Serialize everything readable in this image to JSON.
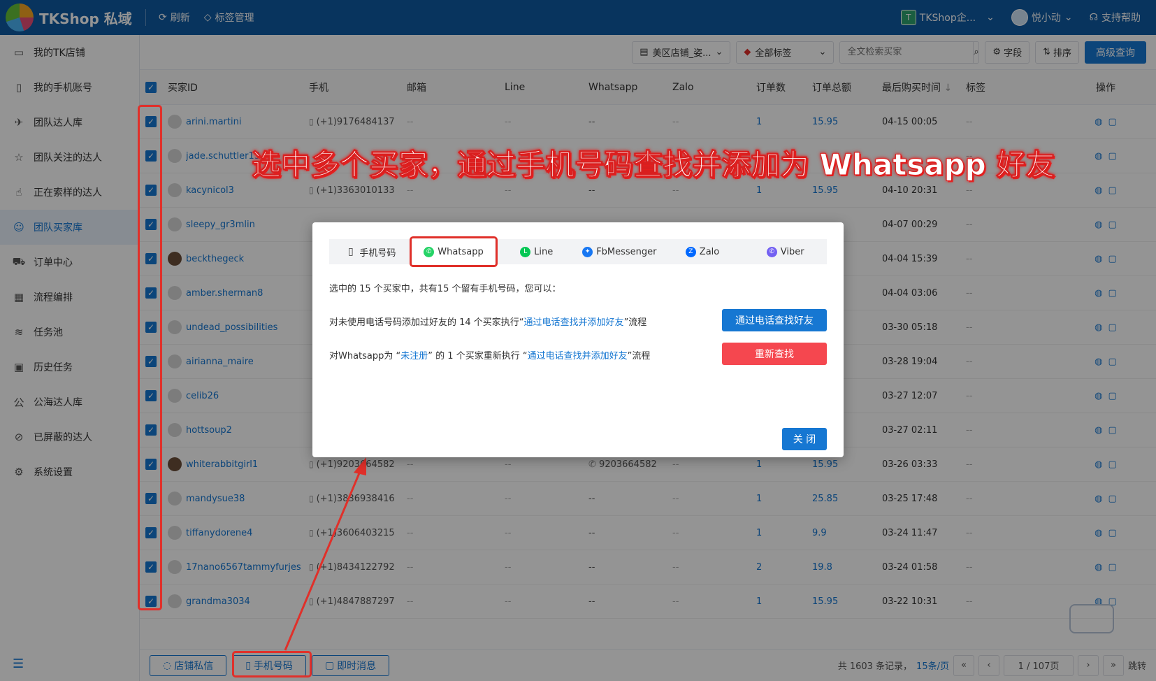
{
  "app": {
    "title": "TKShop 私域"
  },
  "topbar": {
    "refresh": "刷新",
    "tags": "标签管理",
    "org_badge": "T",
    "org": "TKShop企...",
    "user": "悦小动",
    "help": "支持帮助"
  },
  "sidebar": {
    "items": [
      {
        "label": "我的TK店铺",
        "icon": "store-icon",
        "glyph": "▭"
      },
      {
        "label": "我的手机账号",
        "icon": "phone-icon",
        "glyph": "▯"
      },
      {
        "label": "团队达人库",
        "icon": "team-influencer-icon",
        "glyph": "✈"
      },
      {
        "label": "团队关注的达人",
        "icon": "star-icon",
        "glyph": "☆"
      },
      {
        "label": "正在索样的达人",
        "icon": "hand-icon",
        "glyph": "☝"
      },
      {
        "label": "团队买家库",
        "icon": "buyer-icon",
        "glyph": "☺"
      },
      {
        "label": "订单中心",
        "icon": "truck-icon",
        "glyph": "⛟"
      },
      {
        "label": "流程编排",
        "icon": "calendar-icon",
        "glyph": "▦"
      },
      {
        "label": "任务池",
        "icon": "layers-icon",
        "glyph": "≋"
      },
      {
        "label": "历史任务",
        "icon": "clipboard-icon",
        "glyph": "▣"
      },
      {
        "label": "公海达人库",
        "icon": "public-icon",
        "glyph": "公"
      },
      {
        "label": "已屏蔽的达人",
        "icon": "ban-icon",
        "glyph": "⊘"
      },
      {
        "label": "系统设置",
        "icon": "gear-icon",
        "glyph": "⚙"
      }
    ]
  },
  "toolbar": {
    "shop": "美区店铺_姿...",
    "tags": "全部标签",
    "search_placeholder": "全文检索买家",
    "fields": "字段",
    "sort": "排序",
    "advanced": "高级查询"
  },
  "table": {
    "headers": [
      "买家ID",
      "手机",
      "邮箱",
      "Line",
      "Whatsapp",
      "Zalo",
      "订单数",
      "订单总额",
      "最后购买时间",
      "标签",
      "操作"
    ],
    "rows": [
      {
        "id": "arini.martini",
        "phone": "(+1)9176484137",
        "email": "--",
        "line": "--",
        "wa": "--",
        "zalo": "--",
        "count": "1",
        "amount": "15.95",
        "time": "04-15 00:05",
        "tag": "--",
        "avatar": "default"
      },
      {
        "id": "jade.schuttler13",
        "phone": "",
        "email": "",
        "line": "",
        "wa": "",
        "zalo": "",
        "count": "",
        "amount": "",
        "time": "",
        "tag": "--",
        "avatar": "default"
      },
      {
        "id": "kacynicol3",
        "phone": "(+1)3363010133",
        "email": "--",
        "line": "--",
        "wa": "--",
        "zalo": "--",
        "count": "1",
        "amount": "15.95",
        "time": "04-10 20:31",
        "tag": "--",
        "avatar": "default"
      },
      {
        "id": "sleepy_gr3mlin",
        "phone": "",
        "email": "",
        "line": "",
        "wa": "",
        "zalo": "",
        "count": "",
        "amount": "",
        "time": "04-07 00:29",
        "tag": "--",
        "avatar": "default"
      },
      {
        "id": "beckthegeck",
        "phone": "",
        "email": "",
        "line": "",
        "wa": "",
        "zalo": "",
        "count": "",
        "amount": "",
        "time": "04-04 15:39",
        "tag": "--",
        "avatar": "dark"
      },
      {
        "id": "amber.sherman8",
        "phone": "",
        "email": "",
        "line": "",
        "wa": "",
        "zalo": "",
        "count": "",
        "amount": "",
        "time": "04-04 03:06",
        "tag": "--",
        "avatar": "default"
      },
      {
        "id": "undead_possibilities",
        "phone": "",
        "email": "",
        "line": "",
        "wa": "",
        "zalo": "",
        "count": "",
        "amount": "",
        "time": "03-30 05:18",
        "tag": "--",
        "avatar": "default"
      },
      {
        "id": "airianna_maire",
        "phone": "",
        "email": "",
        "line": "",
        "wa": "",
        "zalo": "",
        "count": "",
        "amount": "",
        "time": "03-28 19:04",
        "tag": "--",
        "avatar": "default"
      },
      {
        "id": "celib26",
        "phone": "",
        "email": "",
        "line": "",
        "wa": "",
        "zalo": "",
        "count": "",
        "amount": "",
        "time": "03-27 12:07",
        "tag": "--",
        "avatar": "default"
      },
      {
        "id": "hottsoup2",
        "phone": "",
        "email": "",
        "line": "",
        "wa": "",
        "zalo": "",
        "count": "",
        "amount": "",
        "time": "03-27 02:11",
        "tag": "--",
        "avatar": "default"
      },
      {
        "id": "whiterabbitgirl1",
        "phone": "(+1)9203664582",
        "email": "--",
        "line": "--",
        "wa": "9203664582",
        "zalo": "--",
        "count": "1",
        "amount": "15.95",
        "time": "03-26 03:33",
        "tag": "--",
        "avatar": "dark"
      },
      {
        "id": "mandysue38",
        "phone": "(+1)3836938416",
        "email": "--",
        "line": "--",
        "wa": "--",
        "zalo": "--",
        "count": "1",
        "amount": "25.85",
        "time": "03-25 17:48",
        "tag": "--",
        "avatar": "default"
      },
      {
        "id": "tiffanydorene4",
        "phone": "(+1)3606403215",
        "email": "--",
        "line": "--",
        "wa": "--",
        "zalo": "--",
        "count": "1",
        "amount": "9.9",
        "time": "03-24 11:47",
        "tag": "--",
        "avatar": "default"
      },
      {
        "id": "17nano6567tammyfurjes",
        "phone": "(+1)8434122792",
        "email": "--",
        "line": "--",
        "wa": "--",
        "zalo": "--",
        "count": "2",
        "amount": "19.8",
        "time": "03-24 01:58",
        "tag": "--",
        "avatar": "default"
      },
      {
        "id": "grandma3034",
        "phone": "(+1)4847887297",
        "email": "--",
        "line": "--",
        "wa": "--",
        "zalo": "--",
        "count": "1",
        "amount": "15.95",
        "time": "03-22 10:31",
        "tag": "--",
        "avatar": "default"
      }
    ]
  },
  "footer": {
    "shop_msg": "店铺私信",
    "phone": "手机号码",
    "instant": "即时消息",
    "total": "共 1603 条记录，",
    "page_size": "15条/页",
    "page": "1 / 107页",
    "jump": "跳转"
  },
  "caption": "选中多个买家，通过手机号码查找并添加为 Whatsapp 好友",
  "modal": {
    "tabs": [
      {
        "label": "手机号码",
        "icon": "phone-icon",
        "glyph": "▯",
        "color": "",
        "active": false
      },
      {
        "label": "Whatsapp",
        "icon": "whatsapp-icon",
        "glyph": "✆",
        "color": "#25d366",
        "active": true
      },
      {
        "label": "Line",
        "icon": "line-icon",
        "glyph": "L",
        "color": "#06c755",
        "active": false
      },
      {
        "label": "FbMessenger",
        "icon": "messenger-icon",
        "glyph": "✦",
        "color": "#1877f2",
        "active": false
      },
      {
        "label": "Zalo",
        "icon": "zalo-icon",
        "glyph": "Z",
        "color": "#0068ff",
        "active": false
      },
      {
        "label": "Viber",
        "icon": "viber-icon",
        "glyph": "✆",
        "color": "#7360f2",
        "active": false
      }
    ],
    "summary": "选中的 15 个买家中，共有15 个留有手机号码，您可以：",
    "line1_pre": "对未使用电话号码添加过好友的 14 个买家执行“",
    "line1_link": "通过电话查找并添加好友",
    "line1_post": "”流程",
    "btn1": "通过电话查找好友",
    "line2_pre": "对Whatsapp为 “",
    "line2_status": "未注册",
    "line2_mid": "” 的 1 个买家重新执行 “",
    "line2_link": "通过电话查找并添加好友",
    "line2_post": "”流程",
    "btn2": "重新查找",
    "close": "关 闭"
  },
  "colors": {
    "primary": "#1677d2",
    "header": "#0f5aa3",
    "danger": "#f5474f",
    "highlight": "#e0302a"
  }
}
